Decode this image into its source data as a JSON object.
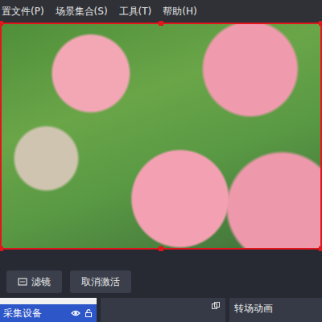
{
  "menu": [
    {
      "label": "置文件(P)"
    },
    {
      "label": "场景集合(S)"
    },
    {
      "label": "工具(T)"
    },
    {
      "label": "帮助(H)"
    }
  ],
  "controls": [
    {
      "label": "滤镜"
    },
    {
      "label": "取消激活"
    }
  ],
  "sources": [
    {
      "name": "采集设备",
      "selected": true,
      "visible": true,
      "locked": false
    }
  ],
  "transition_dock": {
    "title": "转场动画"
  }
}
